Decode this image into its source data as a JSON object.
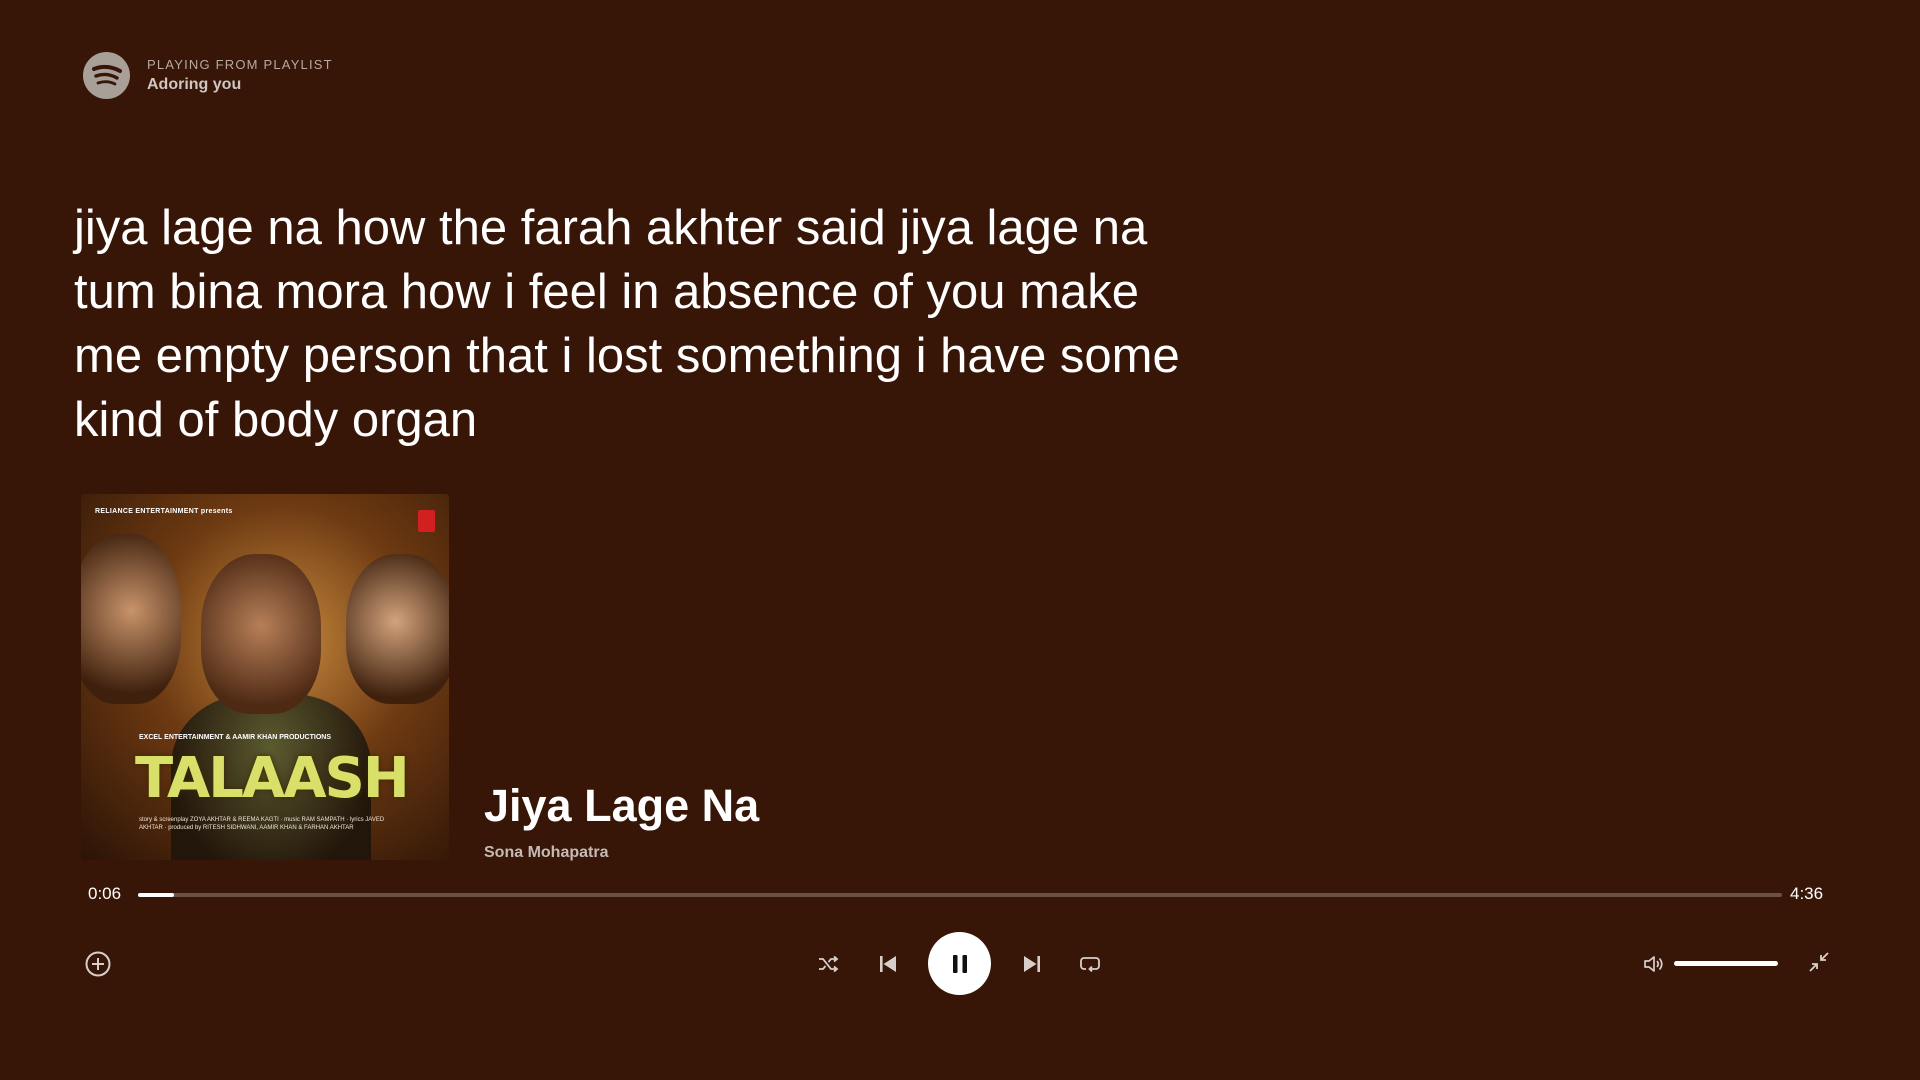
{
  "header": {
    "context_label": "PLAYING FROM PLAYLIST",
    "context_name": "Adoring you",
    "logo_icon": "spotify-logo-icon"
  },
  "lyrics": {
    "text": "jiya lage na how the farah akhter said jiya lage na tum bina mora how i feel in absence of you make me empty person that i lost something i have some kind of body organ"
  },
  "album_art": {
    "top_text": "RELIANCE ENTERTAINMENT presents",
    "production_text": "EXCEL ENTERTAINMENT & AAMIR KHAN PRODUCTIONS",
    "title_text": "TALAASH",
    "credits_text": "story & screenplay ZOYA AKHTAR & REEMA KAGTI · music RAM SAMPATH · lyrics JAVED AKHTAR · produced by RITESH SIDHWANI, AAMIR KHAN & FARHAN AKHTAR"
  },
  "track": {
    "title": "Jiya Lage Na",
    "artist": "Sona Mohapatra"
  },
  "playback": {
    "current_time": "0:06",
    "total_time": "4:36",
    "progress_fraction": 0.022,
    "state": "playing",
    "volume_fraction": 1.0
  },
  "controls": {
    "add_icon": "add-circle-icon",
    "shuffle_icon": "shuffle-icon",
    "previous_icon": "skip-previous-icon",
    "pause_icon": "pause-icon",
    "next_icon": "skip-next-icon",
    "repeat_icon": "repeat-icon",
    "volume_icon": "volume-icon",
    "minimize_icon": "minimize-fullscreen-icon"
  },
  "colors": {
    "background": "#371607",
    "text_primary": "#ffffff",
    "text_secondary": "#c6bab4",
    "track_bg": "#6b5046"
  }
}
